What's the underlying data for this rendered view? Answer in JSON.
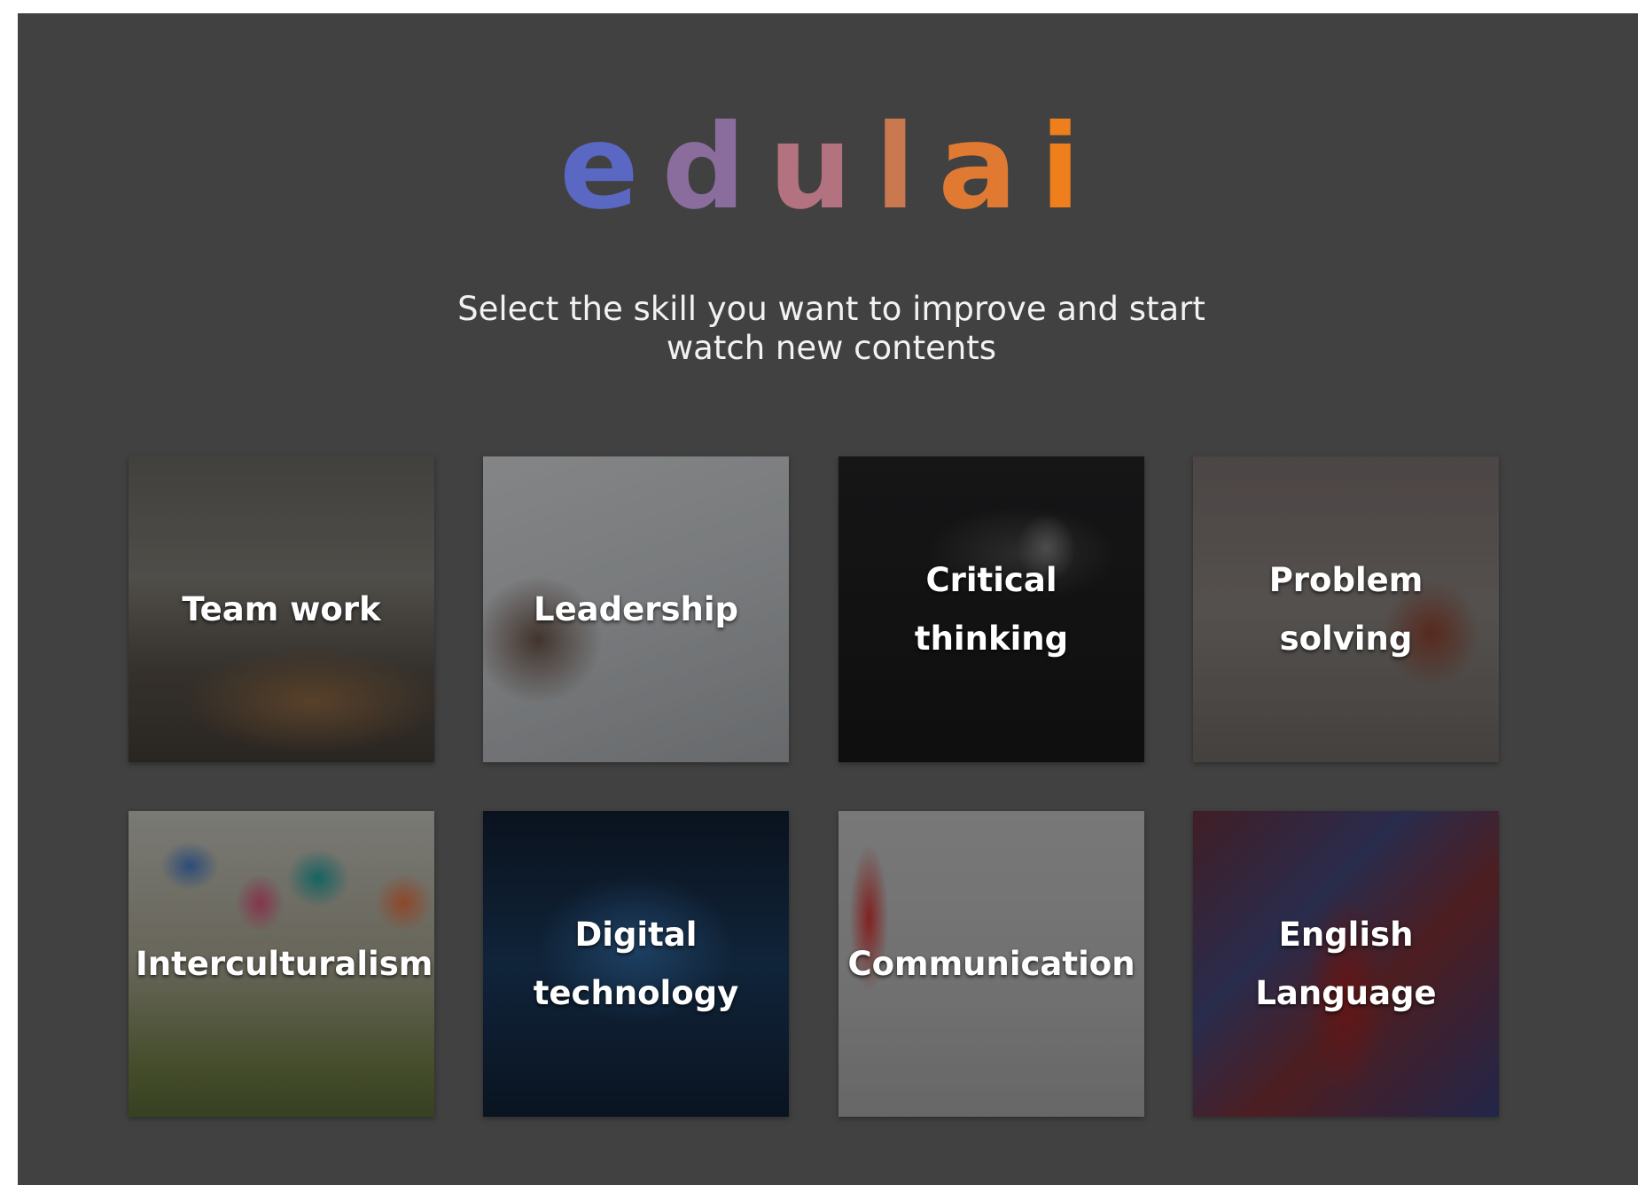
{
  "app": {
    "logo_letters": [
      "e",
      "d",
      "u",
      "l",
      "a",
      "i"
    ],
    "logo_colors": [
      "#5a68c4",
      "#8a6d9c",
      "#b2727f",
      "#c9784f",
      "#e07a33",
      "#ef7f1c"
    ],
    "subtitle_lines": [
      "Select the skill you want to improve and start",
      "watch new contents"
    ]
  },
  "skills": [
    {
      "label_lines": [
        "Team work"
      ],
      "image": "office-teamwork-photo"
    },
    {
      "label_lines": [
        "Leadership"
      ],
      "image": "whiteboard-presenter-photo"
    },
    {
      "label_lines": [
        "Critical thinking"
      ],
      "image": "lightbulb-chalkboard-photo"
    },
    {
      "label_lines": [
        "Problem",
        "solving"
      ],
      "image": "rubiks-cube-photo"
    },
    {
      "label_lines": [
        "Interculturalism"
      ],
      "image": "speech-bubble-signs-photo"
    },
    {
      "label_lines": [
        "Digital",
        "technology"
      ],
      "image": "network-lines-photo"
    },
    {
      "label_lines": [
        "Communication"
      ],
      "image": "red-telephone-photo"
    },
    {
      "label_lines": [
        "English",
        "Language"
      ],
      "image": "union-jack-phone-booth-photo"
    }
  ],
  "colors": {
    "background": "#414141",
    "text": "#ffffff"
  }
}
